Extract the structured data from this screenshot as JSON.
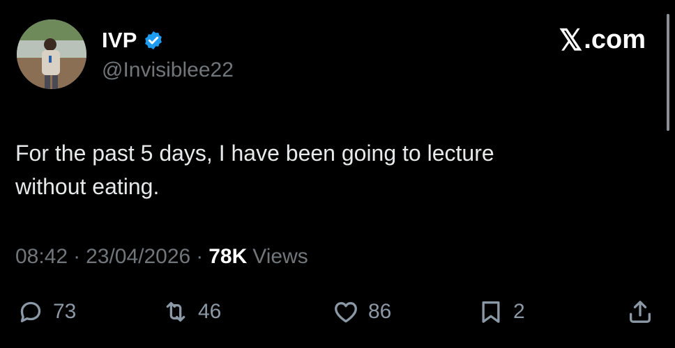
{
  "author": {
    "display_name": "IVP",
    "handle": "@Invisiblee22",
    "verified": true
  },
  "brand": {
    "x_glyph": "𝕏",
    "domain": ".com"
  },
  "tweet": {
    "text_line1": "For the past 5 days, I have been going to lecture",
    "text_line2": "without eating."
  },
  "meta": {
    "time": "08:42",
    "separator": "·",
    "date": "23/04/2026",
    "views_count": "78K",
    "views_label": "Views"
  },
  "actions": {
    "reply_count": "73",
    "repost_count": "46",
    "like_count": "86",
    "bookmark_count": "2"
  },
  "colors": {
    "background": "#000000",
    "text": "#e7e9ea",
    "muted": "#71767b",
    "verified_blue": "#1d9bf0"
  },
  "icons": [
    "verified-badge-icon",
    "reply-icon",
    "repost-icon",
    "like-icon",
    "bookmark-icon",
    "share-icon"
  ]
}
